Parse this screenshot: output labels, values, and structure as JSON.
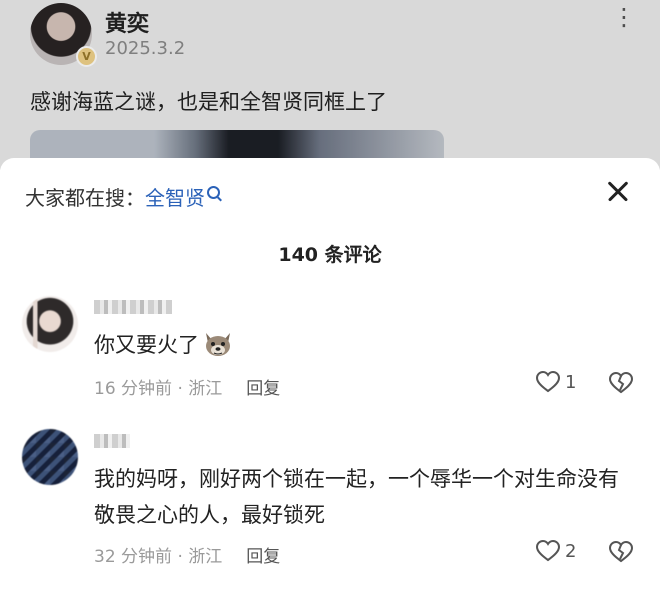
{
  "post": {
    "author": "黄奕",
    "date": "2025.3.2",
    "text": "感谢海蓝之谜，也是和全智贤同框上了",
    "menu_icon": "⋮",
    "badge": "V"
  },
  "sheet": {
    "search_prefix": "大家都在搜：",
    "search_term": "全智贤",
    "comment_count_label": "140 条评论"
  },
  "comments": [
    {
      "text": "你又要火了",
      "sticker": "wolf-face-emoji",
      "time_location": "16 分钟前 · 浙江",
      "reply_label": "回复",
      "likes": "1"
    },
    {
      "text": "我的妈呀，刚好两个锁在一起，一个辱华一个对生命没有敬畏之心的人，最好锁死",
      "time_location": "32 分钟前 · 浙江",
      "reply_label": "回复",
      "likes": "2"
    }
  ]
}
